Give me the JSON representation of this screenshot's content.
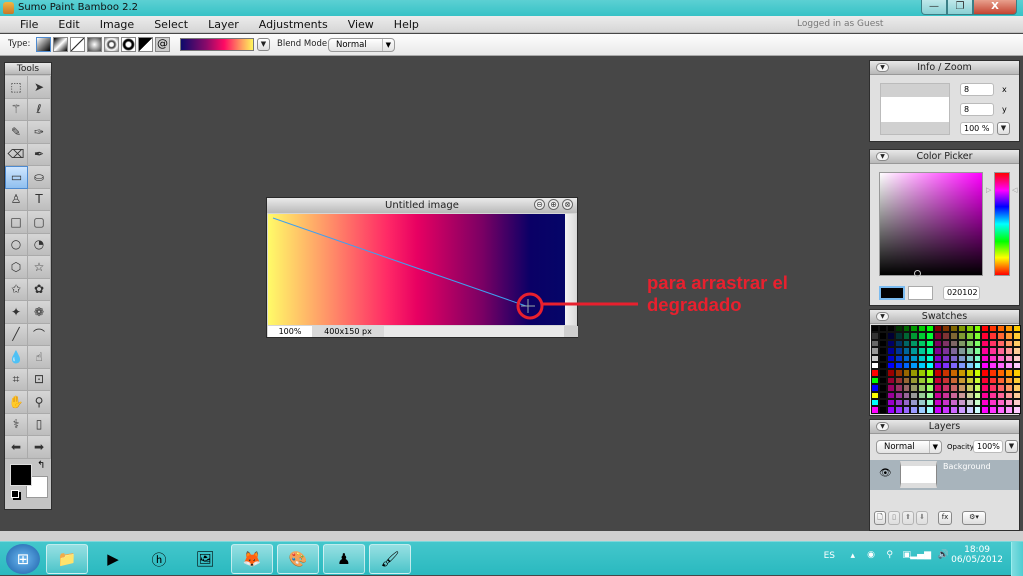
{
  "window": {
    "title": "Sumo Paint Bamboo 2.2",
    "minimize": "—",
    "restore": "❐",
    "close": "X"
  },
  "menu": {
    "items": [
      "File",
      "Edit",
      "Image",
      "Select",
      "Layer",
      "Adjustments",
      "View",
      "Help"
    ],
    "status": "Logged in as Guest"
  },
  "toolbar": {
    "type_label": "Type:",
    "gradient_types": [
      "linear",
      "reflected",
      "diagonal",
      "square",
      "radial",
      "ring",
      "angle",
      "spiral"
    ],
    "blend_label": "Blend Mode:",
    "blend_value": "Normal",
    "gradient_colors": [
      "#0d0a6b",
      "#8a0a6a",
      "#ff0a64",
      "#ffa35f",
      "#fff55a"
    ]
  },
  "tools": {
    "title": "Tools",
    "items": [
      {
        "name": "rect-select",
        "glyph": "⬚"
      },
      {
        "name": "move",
        "glyph": "➤"
      },
      {
        "name": "magic-wand",
        "glyph": "⚚"
      },
      {
        "name": "lasso",
        "glyph": "ℓ"
      },
      {
        "name": "pencil",
        "glyph": "✎"
      },
      {
        "name": "brush",
        "glyph": "✑"
      },
      {
        "name": "eraser",
        "glyph": "⌫"
      },
      {
        "name": "airbrush",
        "glyph": "✒"
      },
      {
        "name": "gradient",
        "glyph": "▭",
        "active": true
      },
      {
        "name": "paint-bucket",
        "glyph": "⛀"
      },
      {
        "name": "stamp",
        "glyph": "♙"
      },
      {
        "name": "text",
        "glyph": "T"
      },
      {
        "name": "rectangle",
        "glyph": "□"
      },
      {
        "name": "rounded-rectangle",
        "glyph": "▢"
      },
      {
        "name": "ellipse",
        "glyph": "○"
      },
      {
        "name": "pie",
        "glyph": "◔"
      },
      {
        "name": "polygon",
        "glyph": "⬡"
      },
      {
        "name": "star",
        "glyph": "☆"
      },
      {
        "name": "star-burst",
        "glyph": "✩"
      },
      {
        "name": "flower",
        "glyph": "✿"
      },
      {
        "name": "custom-shape",
        "glyph": "✦"
      },
      {
        "name": "flower-filled",
        "glyph": "❁"
      },
      {
        "name": "line",
        "glyph": "╱"
      },
      {
        "name": "curve",
        "glyph": "⌒"
      },
      {
        "name": "blur",
        "glyph": "💧"
      },
      {
        "name": "smudge",
        "glyph": "☝"
      },
      {
        "name": "crop",
        "glyph": "⌗"
      },
      {
        "name": "transform",
        "glyph": "⊡"
      },
      {
        "name": "hand",
        "glyph": "✋"
      },
      {
        "name": "zoom",
        "glyph": "⚲"
      },
      {
        "name": "eyedropper",
        "glyph": "⚕"
      },
      {
        "name": "trash",
        "glyph": "▯"
      },
      {
        "name": "undo",
        "glyph": "⬅"
      },
      {
        "name": "redo",
        "glyph": "➡"
      }
    ],
    "swap_glyph": "↰"
  },
  "image_window": {
    "title": "Untitled image",
    "zoom": "100%",
    "dimensions": "400x150 px",
    "buttons": [
      "⊖",
      "⊕",
      "⊗"
    ]
  },
  "annotation": {
    "line1": "para arrastrar el",
    "line2": "degradado",
    "color": "#e8202e"
  },
  "info_zoom": {
    "title": "Info / Zoom",
    "x": "8",
    "x_label": "x",
    "y": "8",
    "y_label": "y",
    "zoom": "100 %"
  },
  "color_picker": {
    "title": "Color Picker",
    "hex": "020102",
    "fg": "#020102",
    "bg": "#ffffff",
    "hue": "#ff00ff"
  },
  "swatches": {
    "title": "Swatches"
  },
  "layers": {
    "title": "Layers",
    "blend": "Normal",
    "opacity_label": "Opacity:",
    "opacity": "100%",
    "layer_name": "Background"
  },
  "taskbar": {
    "apps": [
      "start",
      "explorer",
      "media-player",
      "hp",
      "photo-gallery",
      "firefox",
      "paint-app",
      "sumo-paint",
      "paint"
    ],
    "lang": "ES",
    "time": "18:09",
    "date": "06/05/2012"
  }
}
